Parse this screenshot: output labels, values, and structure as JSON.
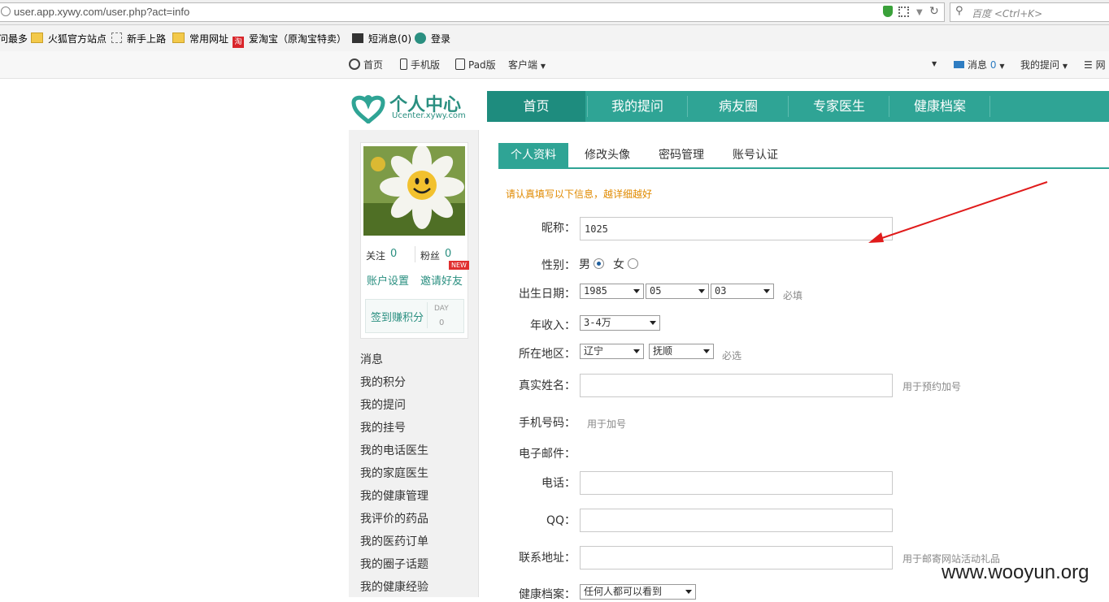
{
  "browser": {
    "url": "user.app.xywy.com/user.php?act=info",
    "search_placeholder": "百度 <Ctrl+K>",
    "bookmarks": [
      "问最多",
      "火狐官方站点",
      "新手上路",
      "常用网址",
      "爱淘宝（原淘宝特卖）",
      "短消息(0)",
      "登录"
    ]
  },
  "topnav": {
    "home": "首页",
    "mobile": "手机版",
    "pad": "Pad版",
    "client": "客户端",
    "messages": "消息",
    "messages_count": "0",
    "my_questions": "我的提问",
    "more": "网"
  },
  "header": {
    "logo_title": "个人中心",
    "logo_sub": "Ucenter.xywy.com",
    "nav": [
      "首页",
      "我的提问",
      "病友圈",
      "专家医生",
      "健康档案"
    ]
  },
  "profile": {
    "follow_label": "关注",
    "follow_count": "0",
    "fans_label": "粉丝",
    "fans_count": "0",
    "new_badge": "NEW",
    "account_settings": "账户设置",
    "invite_friends": "邀请好友",
    "checkin": "签到赚积分",
    "day_label": "DAY",
    "day_count": "0"
  },
  "sidebar_menu": [
    "消息",
    "我的积分",
    "我的提问",
    "我的挂号",
    "我的电话医生",
    "我的家庭医生",
    "我的健康管理",
    "我评价的药品",
    "我的医药订单",
    "我的圈子话题",
    "我的健康经验"
  ],
  "tabs": [
    "个人资料",
    "修改头像",
    "密码管理",
    "账号认证"
  ],
  "form": {
    "notice": "请认真填写以下信息，越详细越好",
    "nickname_label": "昵称：",
    "nickname_value": "1025",
    "gender_label": "性别：",
    "gender_male": "男",
    "gender_female": "女",
    "birth_label": "出生日期：",
    "birth_year": "1985",
    "birth_month": "05",
    "birth_day": "03",
    "required_1": "必填",
    "income_label": "年收入：",
    "income_value": "3-4万",
    "region_label": "所在地区：",
    "province": "辽宁",
    "city": "抚顺",
    "required_2": "必选",
    "realname_label": "真实姓名：",
    "realname_hint": "用于预约加号",
    "phone_label": "手机号码：",
    "phone_hint": "用于加号",
    "email_label": "电子邮件：",
    "tel_label": "电话：",
    "qq_label": "QQ：",
    "address_label": "联系地址：",
    "address_hint": "用于邮寄网站活动礼品",
    "health_label": "健康档案：",
    "health_value": "任何人都可以看到"
  },
  "watermark": "www.wooyun.org"
}
